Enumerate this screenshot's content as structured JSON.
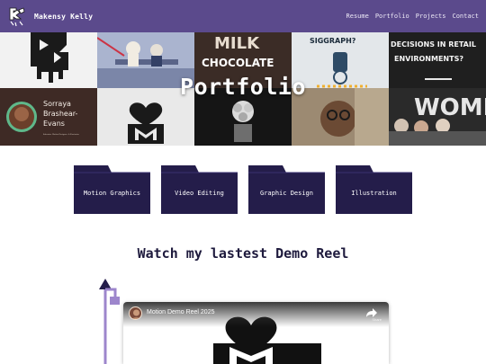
{
  "nav": {
    "brand": "Makensy Kelly",
    "links": [
      "Resume",
      "Portfolio",
      "Projects",
      "Contact"
    ]
  },
  "hero": {
    "title": "Portfolio",
    "tiles": {
      "chocolate_line1": "MILK",
      "chocolate_line2": "CHOCOLATE",
      "siggraph": "SIGGRAPH?",
      "retail_line1": "DECISIONS IN RETAIL",
      "retail_line2": "ENVIRONMENTS?",
      "name_line1": "Sorraya",
      "name_line2": "Brashear-",
      "name_line3": "Evans",
      "name_caption": "Educator, Motion Designer, & Illustrator",
      "women": "WOME"
    }
  },
  "folders": [
    "Motion Graphics",
    "Video Editing",
    "Graphic Design",
    "Illustration"
  ],
  "demo": {
    "heading": "Watch my lastest Demo Reel",
    "video_title": "Motion Demo Reel 2025",
    "share_label": "Share"
  },
  "colors": {
    "nav_bg": "#5b4a8c",
    "folder": "#241d4a",
    "heading": "#1e1a3d",
    "timeline": "#9d86cc"
  }
}
